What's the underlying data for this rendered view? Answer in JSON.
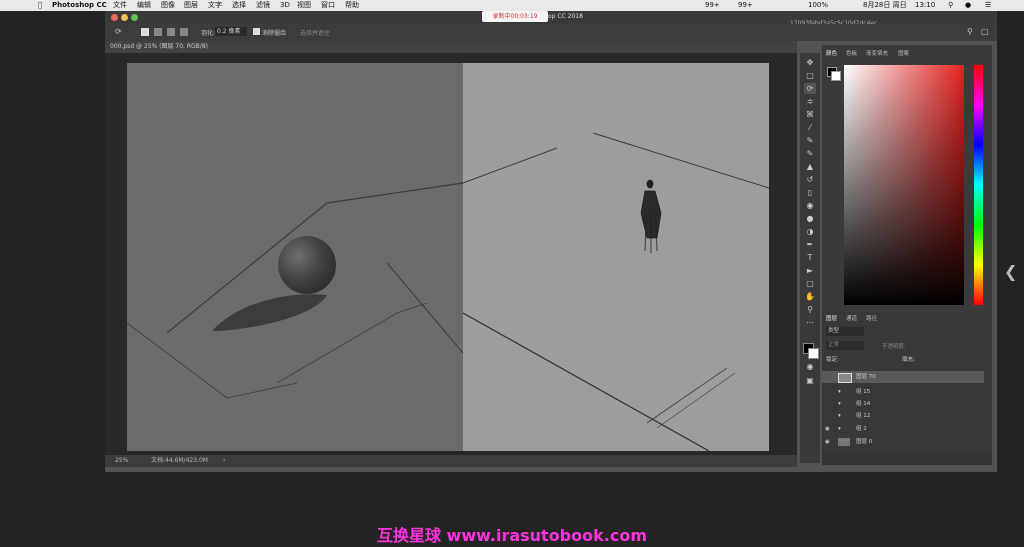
{
  "menubar": {
    "app": "Photoshop CC",
    "items": [
      "文件",
      "编辑",
      "图像",
      "图层",
      "文字",
      "选择",
      "滤镜",
      "3D",
      "视图",
      "窗口",
      "帮助"
    ],
    "status_right": [
      "99+",
      "99+",
      "100%",
      "8月28日 周日",
      "13:10"
    ]
  },
  "window": {
    "recording_badge": "录制中00:03:19",
    "title_fragment": "op CC 2018",
    "hash": "17093febd3a5c5c10d7dc4ec"
  },
  "options": {
    "feather_label": "羽化:",
    "feather_value": "0.2 像素",
    "anti_alias": "消除锯齿",
    "select_mask": "选择并遮住"
  },
  "document": {
    "tab": "000.psd @ 25% (图层 70, RGB/8)",
    "zoom": "25%",
    "file_info": "文档:44.6M/423.0M"
  },
  "panels": {
    "top_tabs": [
      "颜色",
      "色板",
      "渐变填充",
      "图案"
    ],
    "layer_tabs": [
      "图层",
      "通道",
      "路径"
    ],
    "layer_kind": "类型",
    "layer_mode": "正常",
    "opacity_label": "不透明度:",
    "lock_label": "锁定:",
    "fill_label": "填充:"
  },
  "layers": [
    {
      "name": "图层 70",
      "selected": true,
      "visible": false,
      "group": false
    },
    {
      "name": "组 15",
      "selected": false,
      "visible": false,
      "group": true
    },
    {
      "name": "组 14",
      "selected": false,
      "visible": false,
      "group": true
    },
    {
      "name": "组 12",
      "selected": false,
      "visible": false,
      "group": true
    },
    {
      "name": "组 2",
      "selected": false,
      "visible": true,
      "group": true
    },
    {
      "name": "图层 0",
      "selected": false,
      "visible": true,
      "group": false
    }
  ],
  "caption": "互换星球 www.irasutobook.com",
  "colors": {
    "menubar_bg": "#e9e9e9",
    "panel_bg": "#3a3a3a",
    "canvas_left": "#6a6b6a",
    "canvas_right": "#9c9d9c",
    "caption_color": "#ff33dd",
    "hue_red": "#e4221f"
  }
}
